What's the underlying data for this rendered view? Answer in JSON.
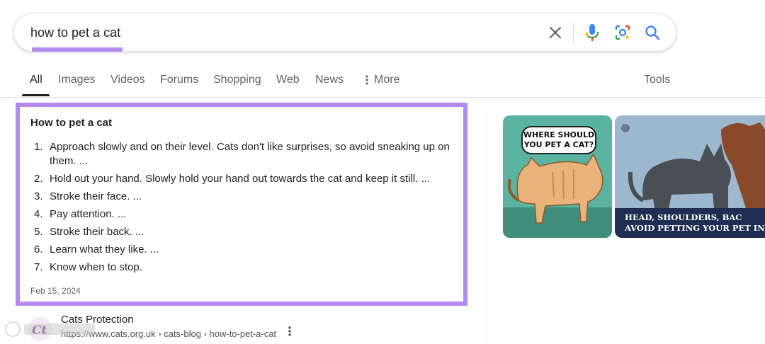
{
  "search": {
    "query": "how to pet a cat",
    "icons": [
      "close-icon",
      "mic-icon",
      "lens-icon",
      "search-icon"
    ]
  },
  "tabs": [
    {
      "label": "All",
      "active": true
    },
    {
      "label": "Images"
    },
    {
      "label": "Videos"
    },
    {
      "label": "Forums"
    },
    {
      "label": "Shopping"
    },
    {
      "label": "Web"
    },
    {
      "label": "News"
    },
    {
      "label": "More",
      "icon": "more-vert-icon"
    },
    {
      "label": "Tools"
    }
  ],
  "snippet": {
    "title": "How to pet a cat",
    "steps": [
      {
        "num": "1.",
        "text": "Approach slowly and on their level. Cats don't like surprises, so avoid sneaking up on them. ..."
      },
      {
        "num": "2.",
        "text": "Hold out your hand. Slowly hold your hand out towards the cat and keep it still. ..."
      },
      {
        "num": "3.",
        "text": "Stroke their face. ..."
      },
      {
        "num": "4.",
        "text": "Pay attention. ..."
      },
      {
        "num": "5.",
        "text": "Stroke their back. ..."
      },
      {
        "num": "6.",
        "text": "Learn what they like. ..."
      },
      {
        "num": "7.",
        "text": "Know when to stop."
      }
    ],
    "date": "Feb 15, 2024"
  },
  "source": {
    "name": "Cats Protection",
    "url": "https://www.cats.org.uk › cats-blog › how-to-pet-a-cat",
    "more_icon": "more-vert-icon"
  },
  "images": [
    {
      "title": "WHERE SHOULD YOU PET A CAT?"
    },
    {
      "caption_line1": "HEAD, SHOULDERS, BAC",
      "caption_line2": "AVOID PETTING YOUR PET IN TH"
    }
  ],
  "colors": {
    "highlight": "#b48af0",
    "accent_blue": "#4285f4"
  }
}
